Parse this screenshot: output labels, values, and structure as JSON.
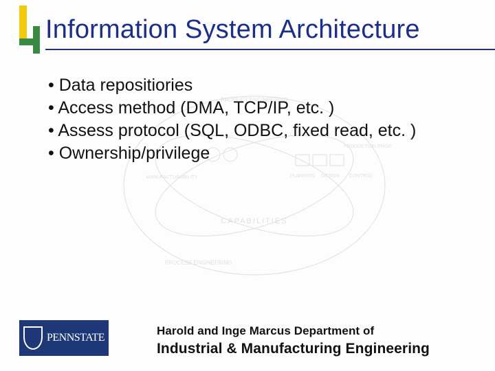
{
  "title": "Information System Architecture",
  "bullets": [
    "Data repositiories",
    "Access method (DMA, TCP/IP, etc. )",
    "Assess protocol (SQL, ODBC, fixed read, etc. )",
    "Ownership/privilege"
  ],
  "footer": {
    "logo_label": "PENNSTATE",
    "dept_line1": "Harold and Inge Marcus Department of",
    "dept_line2": "Industrial & Manufacturing Engineering"
  },
  "bg_labels": {
    "a": "PRODUCT ENGINEERING",
    "b": "MANUFACTURABILITY",
    "c": "PLANNING",
    "d": "DESIGN",
    "e": "CONTROL",
    "f": "PRODUCTION ENGINEERING",
    "g": "CAPABILITIES",
    "h": "PROCESS ENGINEERING"
  }
}
